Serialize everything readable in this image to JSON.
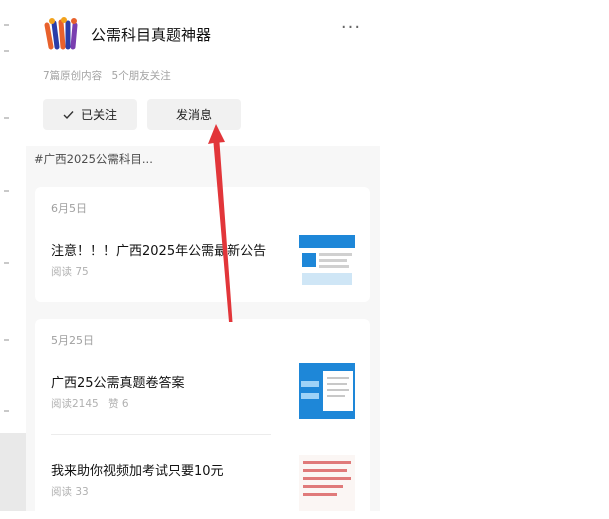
{
  "account": {
    "name": "公需科目真题神器",
    "stats": [
      "7篇原创内容",
      "5个朋友关注"
    ],
    "more_icon": "more-dots-icon"
  },
  "actions": {
    "follow_label": "已关注",
    "message_label": "发消息"
  },
  "tag": "#广西2025公需科目...",
  "groups": [
    {
      "date": "6月5日",
      "articles": [
        {
          "title": "注意！！！广西2025年公需最新公告",
          "meta": [
            "阅读 75"
          ]
        }
      ]
    },
    {
      "date": "5月25日",
      "articles": [
        {
          "title": "广西25公需真题卷答案",
          "meta": [
            "阅读2145",
            "赞 6"
          ]
        },
        {
          "title": "我来助你视频加考试只要10元",
          "meta": [
            "阅读 33"
          ]
        }
      ]
    }
  ],
  "colors": {
    "panel_bg": "#f7f7f7",
    "card_bg": "#ffffff",
    "button_bg": "#f1f1f1",
    "annotation_arrow": "#e2363a",
    "thumb_blue": "#1e87d8"
  }
}
